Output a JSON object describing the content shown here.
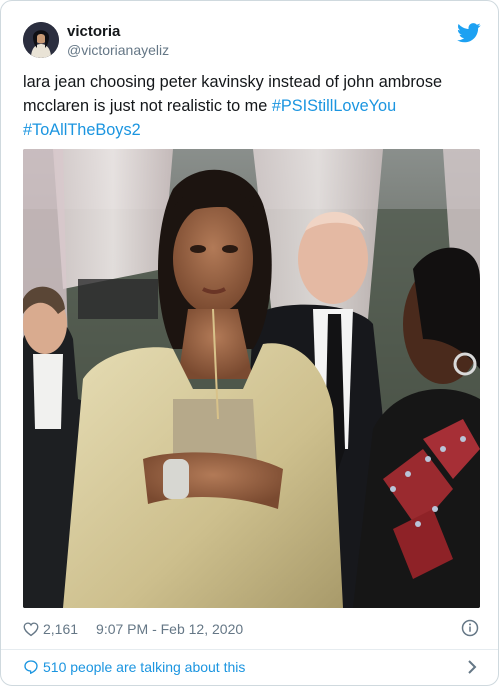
{
  "user": {
    "display_name": "victoria",
    "handle": "@victorianayeliz"
  },
  "tweet": {
    "text": "lara jean choosing peter kavinsky instead of john ambrose mcclaren is just not realistic to me ",
    "hashtags": [
      "#PSIStillLoveYou",
      "#ToAllTheBoys2"
    ]
  },
  "photo": {
    "icon": "photo"
  },
  "meta": {
    "likes": "2,161",
    "time": "9:07 PM - Feb 12, 2020"
  },
  "footer": {
    "talking_text": "510 people are talking about this"
  },
  "colors": {
    "link": "#1b95e0",
    "text": "#14171a",
    "secondary": "#657786",
    "twitter_blue": "#1da1f2"
  }
}
